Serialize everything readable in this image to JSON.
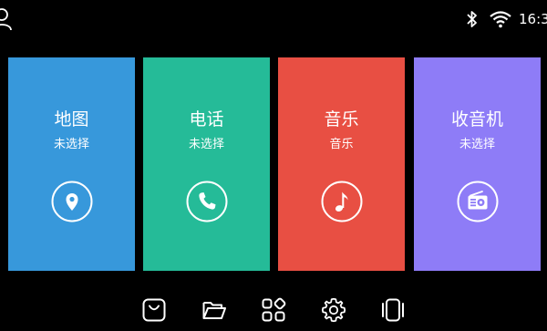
{
  "status_bar": {
    "time": "16:3",
    "icons": [
      "user-icon",
      "bluetooth-icon",
      "wifi-icon"
    ]
  },
  "cards": [
    {
      "title": "地图",
      "subtitle": "未选择",
      "icon": "location-pin-icon",
      "color": "#3798DB"
    },
    {
      "title": "电话",
      "subtitle": "未选择",
      "icon": "phone-icon",
      "color": "#25BB98"
    },
    {
      "title": "音乐",
      "subtitle": "音乐",
      "icon": "music-note-icon",
      "color": "#E84F43"
    },
    {
      "title": "收音机",
      "subtitle": "未选择",
      "icon": "radio-icon",
      "color": "#8E7CF7"
    }
  ],
  "dock": {
    "icons": [
      "shopping-bag-icon",
      "folder-icon",
      "apps-grid-icon",
      "settings-gear-icon",
      "recent-apps-icon"
    ]
  }
}
